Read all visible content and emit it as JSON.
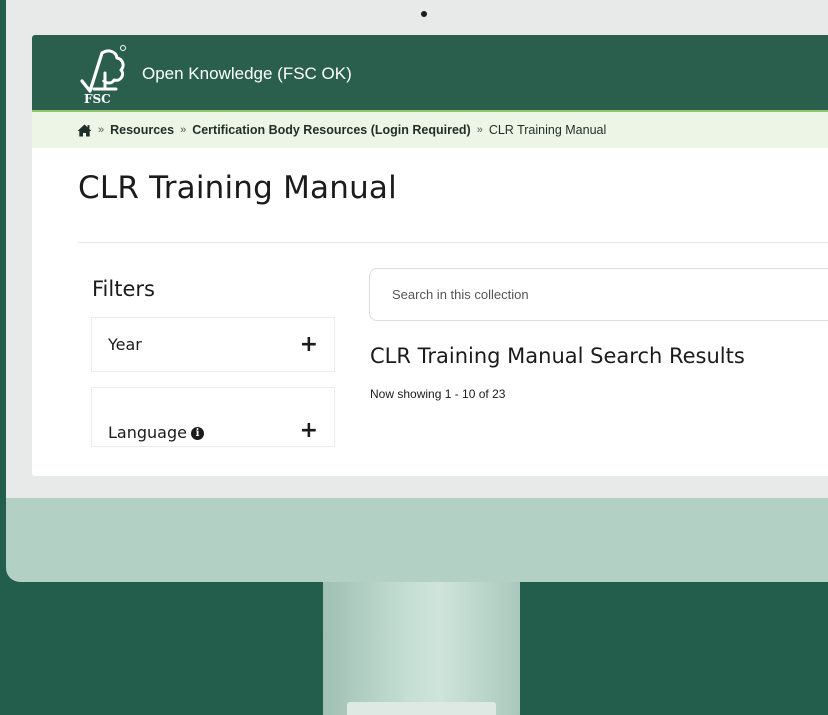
{
  "header": {
    "site_name": "Open Knowledge (FSC OK)",
    "logo_text": "FSC",
    "logo_icon": "fsc-tree-check-logo"
  },
  "breadcrumb": {
    "home_icon": "home-icon",
    "separator": "»",
    "items": [
      {
        "label": "Resources"
      },
      {
        "label": "Certification Body Resources (Login Required)"
      }
    ],
    "current": "CLR Training Manual"
  },
  "page": {
    "title": "CLR Training Manual"
  },
  "filters": {
    "heading": "Filters",
    "items": [
      {
        "label": "Year",
        "toggle": "+"
      },
      {
        "label": "Language",
        "toggle": "+",
        "info_icon": "info-icon"
      }
    ]
  },
  "search": {
    "placeholder": "Search in this collection",
    "value": ""
  },
  "results": {
    "heading": "CLR Training Manual Search Results",
    "count_text": "Now showing 1 - 10 of 23"
  },
  "colors": {
    "header_green": "#2b5f4d",
    "background_green": "#235d4b",
    "breadcrumb_bg": "#edf5e7",
    "breadcrumb_border": "#8fc36c",
    "monitor_chin": "#b3d0c4"
  }
}
